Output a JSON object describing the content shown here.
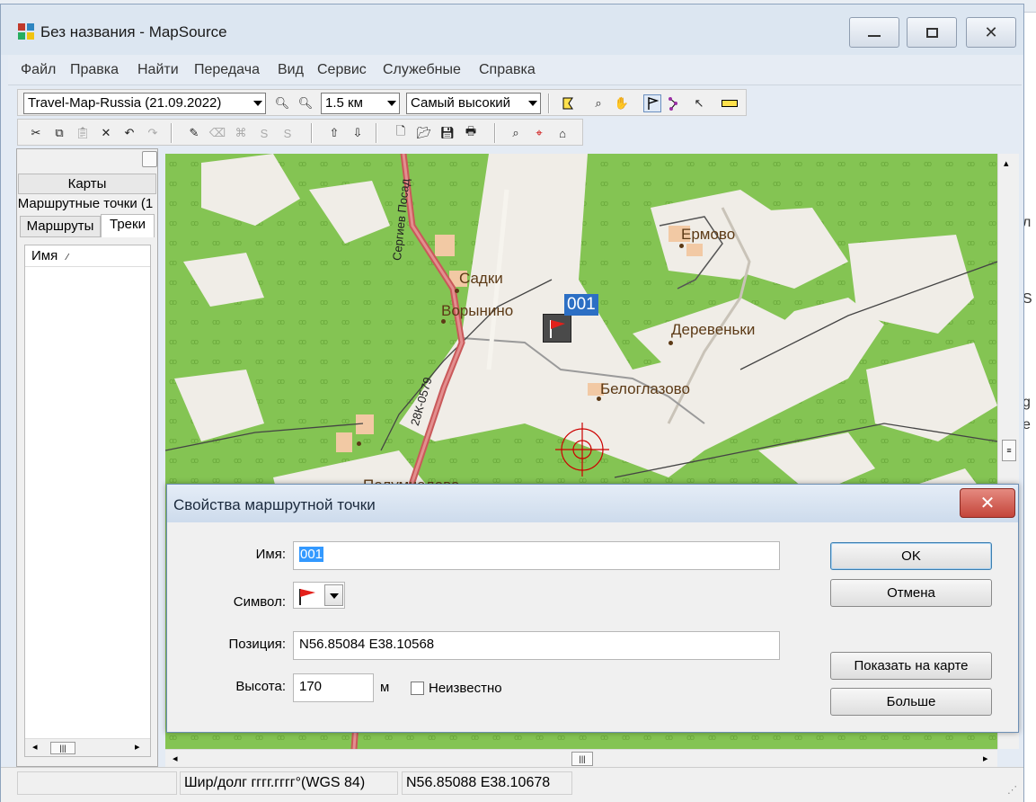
{
  "window": {
    "title": "Без названия - MapSource"
  },
  "menu": [
    "Файл",
    "Правка",
    "Найти",
    "Передача",
    "Вид",
    "Сервис",
    "Служебные",
    "Справка"
  ],
  "toolbar": {
    "map_product": "Travel-Map-Russia (21.09.2022)",
    "zoom_scale": "1.5 км",
    "detail_level": "Самый высокий"
  },
  "sidebar": {
    "tabs": [
      "Карты",
      "Маршрутные точки (1",
      "Маршруты",
      "Треки"
    ],
    "column_header": "Имя"
  },
  "map": {
    "places": [
      "Садки",
      "Ворынино",
      "Ермово",
      "Деревеньки",
      "Белоглазово",
      "Полумчалово"
    ],
    "roads": [
      "Сергиев Посад",
      "28К-0579"
    ],
    "waypoint_label": "001"
  },
  "status": {
    "coord_format": "Шир/долг гггг.гггг°(WGS 84)",
    "cursor_position": "N56.85088 E38.10678"
  },
  "dialog": {
    "title": "Свойства маршрутной точки",
    "name_label": "Имя:",
    "name_value": "001",
    "symbol_label": "Символ:",
    "position_label": "Позиция:",
    "position_value": "N56.85084 E38.10568",
    "altitude_label": "Высота:",
    "altitude_value": "170",
    "altitude_unit": "м",
    "unknown_label": "Неизвестно",
    "ok_button": "OK",
    "cancel_button": "Отмена",
    "show_on_map_button": "Показать на карте",
    "more_button": "Больше"
  },
  "colors": {
    "forest": "#84c453",
    "open_land": "#f0ede7",
    "road_main": "#c9595a",
    "place_text": "#5c3a16",
    "waypoint_badge": "#2c6fc4",
    "close_button": "#c4453a"
  }
}
